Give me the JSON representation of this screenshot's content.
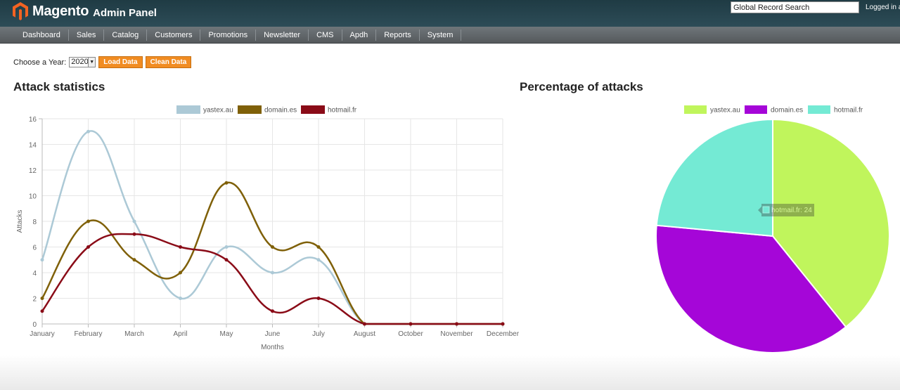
{
  "header": {
    "brand": "Magento",
    "brand_sub": "Admin Panel",
    "search_value": "Global Record Search",
    "logged_in": "Logged in a"
  },
  "nav": [
    "Dashboard",
    "Sales",
    "Catalog",
    "Customers",
    "Promotions",
    "Newsletter",
    "CMS",
    "Apdh",
    "Reports",
    "System"
  ],
  "controls": {
    "year_label": "Choose a Year:",
    "year_value": "2020",
    "load_label": "Load Data",
    "clean_label": "Clean Data"
  },
  "colors": {
    "header": "#2d4c57",
    "accent": "#f18c22"
  },
  "chart_data": [
    {
      "type": "line",
      "title": "Attack statistics",
      "xlabel": "Months",
      "ylabel": "Attacks",
      "ylim": [
        0,
        16
      ],
      "yticks": [
        0,
        2,
        4,
        6,
        8,
        10,
        12,
        14,
        16
      ],
      "grid": true,
      "legend": "top",
      "categories": [
        "January",
        "February",
        "March",
        "April",
        "May",
        "June",
        "July",
        "August",
        "October",
        "November",
        "December"
      ],
      "series": [
        {
          "name": "yastex.au",
          "color": "#acc9d6",
          "values": [
            5,
            15,
            8,
            2,
            6,
            4,
            5,
            0,
            0,
            0,
            0
          ]
        },
        {
          "name": "domain.es",
          "color": "#7f6008",
          "values": [
            2,
            8,
            5,
            4,
            11,
            6,
            6,
            0,
            0,
            0,
            0
          ]
        },
        {
          "name": "hotmail.fr",
          "color": "#8a0b17",
          "values": [
            1,
            6,
            7,
            6,
            5,
            1,
            2,
            0,
            0,
            0,
            0
          ]
        }
      ]
    },
    {
      "type": "pie",
      "title": "Percentage of attacks",
      "legend": "top",
      "labels": [
        "yastex.au",
        "domain.es",
        "hotmail.fr"
      ],
      "values": [
        40,
        38,
        24
      ],
      "colors": [
        "#c0f55c",
        "#a506d8",
        "#74ead4"
      ],
      "tooltip": "hotmail.fr: 24"
    }
  ]
}
